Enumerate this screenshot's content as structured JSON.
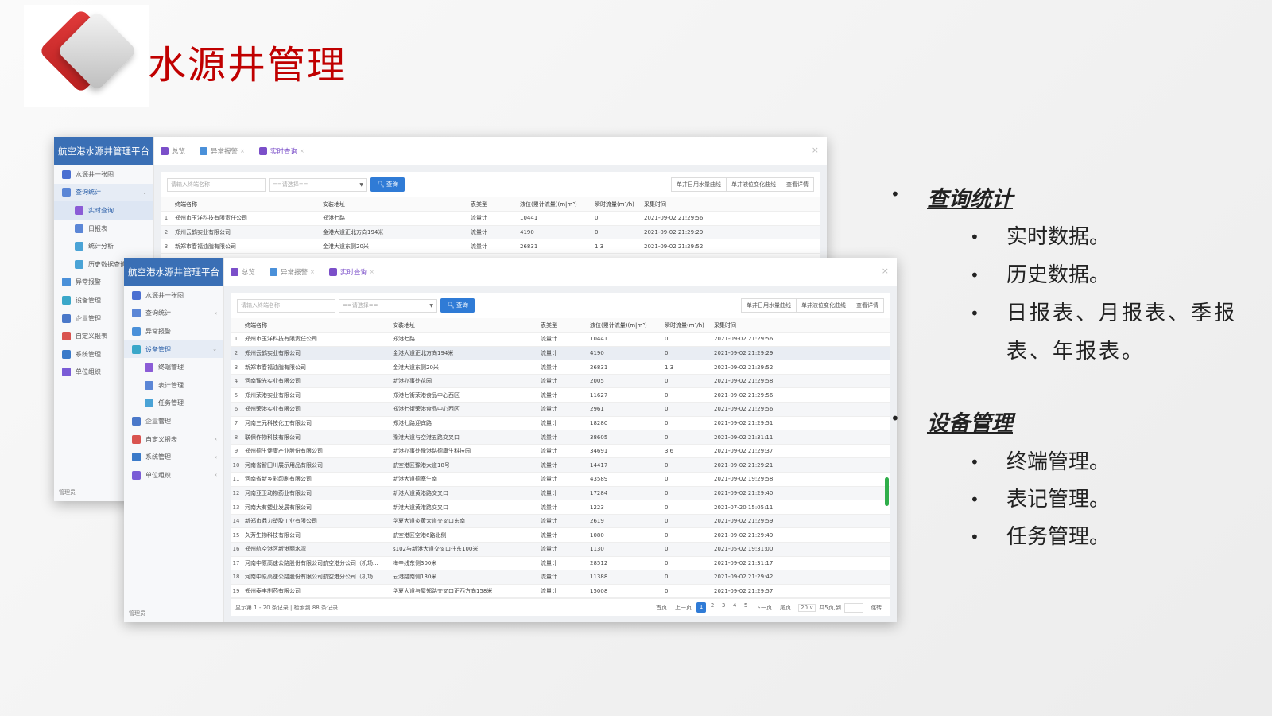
{
  "slide": {
    "title": "水源井管理"
  },
  "app": {
    "brand": "航空港水源井管理平台",
    "admin": "管理员",
    "tabs": [
      {
        "label": "总览",
        "closable": false,
        "active": false
      },
      {
        "label": "异常报警",
        "closable": true,
        "active": false
      },
      {
        "label": "实时查询",
        "closable": true,
        "active": true
      }
    ],
    "close_glyph": "×",
    "search_placeholder": "请输入终端名称",
    "select_placeholder": "==请选择==",
    "search_button": "查询",
    "right_buttons": [
      "单井日用水量曲线",
      "单井液位变化曲线",
      "查看详情"
    ],
    "columns": [
      "终端名称",
      "安装地址",
      "表类型",
      "液位(累计流量)(m|m³)",
      "瞬时流量(m³/h)",
      "采集时间"
    ]
  },
  "back_window": {
    "nav": [
      {
        "label": "水源井一张图",
        "level": 1,
        "state": "normal",
        "arrow": ""
      },
      {
        "label": "查询统计",
        "level": 1,
        "state": "expanded",
        "arrow": "⌄"
      },
      {
        "label": "实时查询",
        "level": 2,
        "state": "active",
        "arrow": ""
      },
      {
        "label": "日报表",
        "level": 2,
        "state": "normal",
        "arrow": ""
      },
      {
        "label": "统计分析",
        "level": 2,
        "state": "normal",
        "arrow": ""
      },
      {
        "label": "历史数据查询",
        "level": 2,
        "state": "normal",
        "arrow": ""
      },
      {
        "label": "异常报警",
        "level": 1,
        "state": "normal",
        "arrow": ""
      },
      {
        "label": "设备管理",
        "level": 1,
        "state": "normal",
        "arrow": ""
      },
      {
        "label": "企业管理",
        "level": 1,
        "state": "normal",
        "arrow": ""
      },
      {
        "label": "自定义报表",
        "level": 1,
        "state": "normal",
        "arrow": ""
      },
      {
        "label": "系统管理",
        "level": 1,
        "state": "normal",
        "arrow": ""
      },
      {
        "label": "单位组织",
        "level": 1,
        "state": "normal",
        "arrow": ""
      }
    ],
    "rows": [
      [
        "1",
        "郑州市玉洋科技有限责任公司",
        "郑港七路",
        "流量计",
        "10441",
        "0",
        "2021-09-02 21:29:56"
      ],
      [
        "2",
        "郑州云鹤实业有限公司",
        "金港大道正北方向194米",
        "流量计",
        "4190",
        "0",
        "2021-09-02 21:29:29"
      ],
      [
        "3",
        "新郑市春福油脂有限公司",
        "金港大道东侧20米",
        "流量计",
        "26831",
        "1.3",
        "2021-09-02 21:29:52"
      ]
    ]
  },
  "front_window": {
    "nav": [
      {
        "label": "水源井一张图",
        "level": 1,
        "state": "normal",
        "arrow": ""
      },
      {
        "label": "查询统计",
        "level": 1,
        "state": "normal",
        "arrow": "‹"
      },
      {
        "label": "异常报警",
        "level": 1,
        "state": "normal",
        "arrow": ""
      },
      {
        "label": "设备管理",
        "level": 1,
        "state": "expanded",
        "arrow": "⌄"
      },
      {
        "label": "终端管理",
        "level": 2,
        "state": "normal",
        "arrow": ""
      },
      {
        "label": "表计管理",
        "level": 2,
        "state": "normal",
        "arrow": ""
      },
      {
        "label": "任务管理",
        "level": 2,
        "state": "normal",
        "arrow": ""
      },
      {
        "label": "企业管理",
        "level": 1,
        "state": "normal",
        "arrow": ""
      },
      {
        "label": "自定义报表",
        "level": 1,
        "state": "normal",
        "arrow": "‹"
      },
      {
        "label": "系统管理",
        "level": 1,
        "state": "normal",
        "arrow": "‹"
      },
      {
        "label": "单位组织",
        "level": 1,
        "state": "normal",
        "arrow": "‹"
      }
    ],
    "rows": [
      [
        "1",
        "郑州市玉洋科技有限责任公司",
        "郑港七路",
        "流量计",
        "10441",
        "0",
        "2021-09-02 21:29:56"
      ],
      [
        "2",
        "郑州云鹤实业有限公司",
        "金港大道正北方向194米",
        "流量计",
        "4190",
        "0",
        "2021-09-02 21:29:29"
      ],
      [
        "3",
        "新郑市春福油脂有限公司",
        "金港大道东侧20米",
        "流量计",
        "26831",
        "1.3",
        "2021-09-02 21:29:52"
      ],
      [
        "4",
        "河南豫光实业有限公司",
        "新港办事处花园",
        "流量计",
        "2005",
        "0",
        "2021-09-02 21:29:58"
      ],
      [
        "5",
        "郑州荣港实业有限公司",
        "郑港七街荣港食品中心西区",
        "流量计",
        "11627",
        "0",
        "2021-09-02 21:29:56"
      ],
      [
        "6",
        "郑州荣港实业有限公司",
        "郑港七街荣港食品中心西区",
        "流量计",
        "2961",
        "0",
        "2021-09-02 21:29:56"
      ],
      [
        "7",
        "河南三元科技化工有限公司",
        "郑港七路迎宾路",
        "流量计",
        "18280",
        "0",
        "2021-09-02 21:29:51"
      ],
      [
        "8",
        "联保作物科技有限公司",
        "豫港大道与空港五路交叉口",
        "流量计",
        "38605",
        "0",
        "2021-09-02 21:31:11"
      ],
      [
        "9",
        "郑州德生健康产业股份有限公司",
        "新港办事处豫港路德康生科技园",
        "流量计",
        "34691",
        "3.6",
        "2021-09-02 21:29:37"
      ],
      [
        "10",
        "河南省智田川展示用品有限公司",
        "航空港区豫港大道18号",
        "流量计",
        "14417",
        "0",
        "2021-09-02 21:29:21"
      ],
      [
        "11",
        "河南省新乡彩印刷有限公司",
        "新港大道德塞生南",
        "流量计",
        "43589",
        "0",
        "2021-09-02 19:29:58"
      ],
      [
        "12",
        "河南亚卫动物药业有限公司",
        "新港大道黄港路交叉口",
        "流量计",
        "17284",
        "0",
        "2021-09-02 21:29:40"
      ],
      [
        "13",
        "河南大有塑业发展有限公司",
        "新港大道黄港路交叉口",
        "流量计",
        "1223",
        "0",
        "2021-07-20 15:05:11"
      ],
      [
        "14",
        "新郑市鼎力塑胶工业有限公司",
        "华夏大道炎黄大道交叉口东南",
        "流量计",
        "2619",
        "0",
        "2021-09-02 21:29:59"
      ],
      [
        "15",
        "久芳生物科技有限公司",
        "航空港区空港6路北侧",
        "流量计",
        "1080",
        "0",
        "2021-09-02 21:29:49"
      ],
      [
        "16",
        "郑州航空港区新港丽水湾",
        "s102与新港大道交叉口往东100米",
        "流量计",
        "1130",
        "0",
        "2021-05-02 19:31:00"
      ],
      [
        "17",
        "河南中原高速公路股份有限公司航空港分公司（机场...",
        "梅辛线东侧300米",
        "流量计",
        "28512",
        "0",
        "2021-09-02 21:31:17"
      ],
      [
        "18",
        "河南中原高速公路股份有限公司航空港分公司（机场...",
        "云港路南侧130米",
        "流量计",
        "11388",
        "0",
        "2021-09-02 21:29:42"
      ],
      [
        "19",
        "郑州泰丰制药有限公司",
        "华夏大道与屋郑路交叉口正西方向158米",
        "流量计",
        "15008",
        "0",
        "2021-09-02 21:29:57"
      ]
    ],
    "pager": {
      "summary": "显示第 1 - 20 条记录 | 检索到 88 条记录",
      "first": "首页",
      "prev": "上一页",
      "pages": [
        "1",
        "2",
        "3",
        "4",
        "5"
      ],
      "current": "1",
      "next": "下一页",
      "last": "尾页",
      "size": "20 ∨",
      "total_pages": "共5页,到",
      "goto": "跳转"
    }
  },
  "bullets": [
    {
      "heading": "查询统计",
      "items": [
        "实时数据。",
        "历史数据。",
        "日报表、月报表、季报表、年报表。"
      ]
    },
    {
      "heading": "设备管理",
      "items": [
        "终端管理。",
        "表记管理。",
        "任务管理。"
      ]
    }
  ],
  "bullet_glyphs": {
    "level1": "•",
    "level2": "•"
  },
  "colors": {
    "title_red": "#c00000",
    "brand_blue": "#3a6fb5",
    "button_blue": "#2f7bd6",
    "active_tab_purple": "#7b4fc9",
    "scroll_green": "#2fae4a"
  },
  "icons": {
    "map": "map-icon",
    "chart": "chart-icon",
    "alarm": "alarm-icon",
    "device": "device-icon",
    "company": "company-icon",
    "report": "report-icon",
    "system": "system-icon",
    "org": "org-icon"
  }
}
